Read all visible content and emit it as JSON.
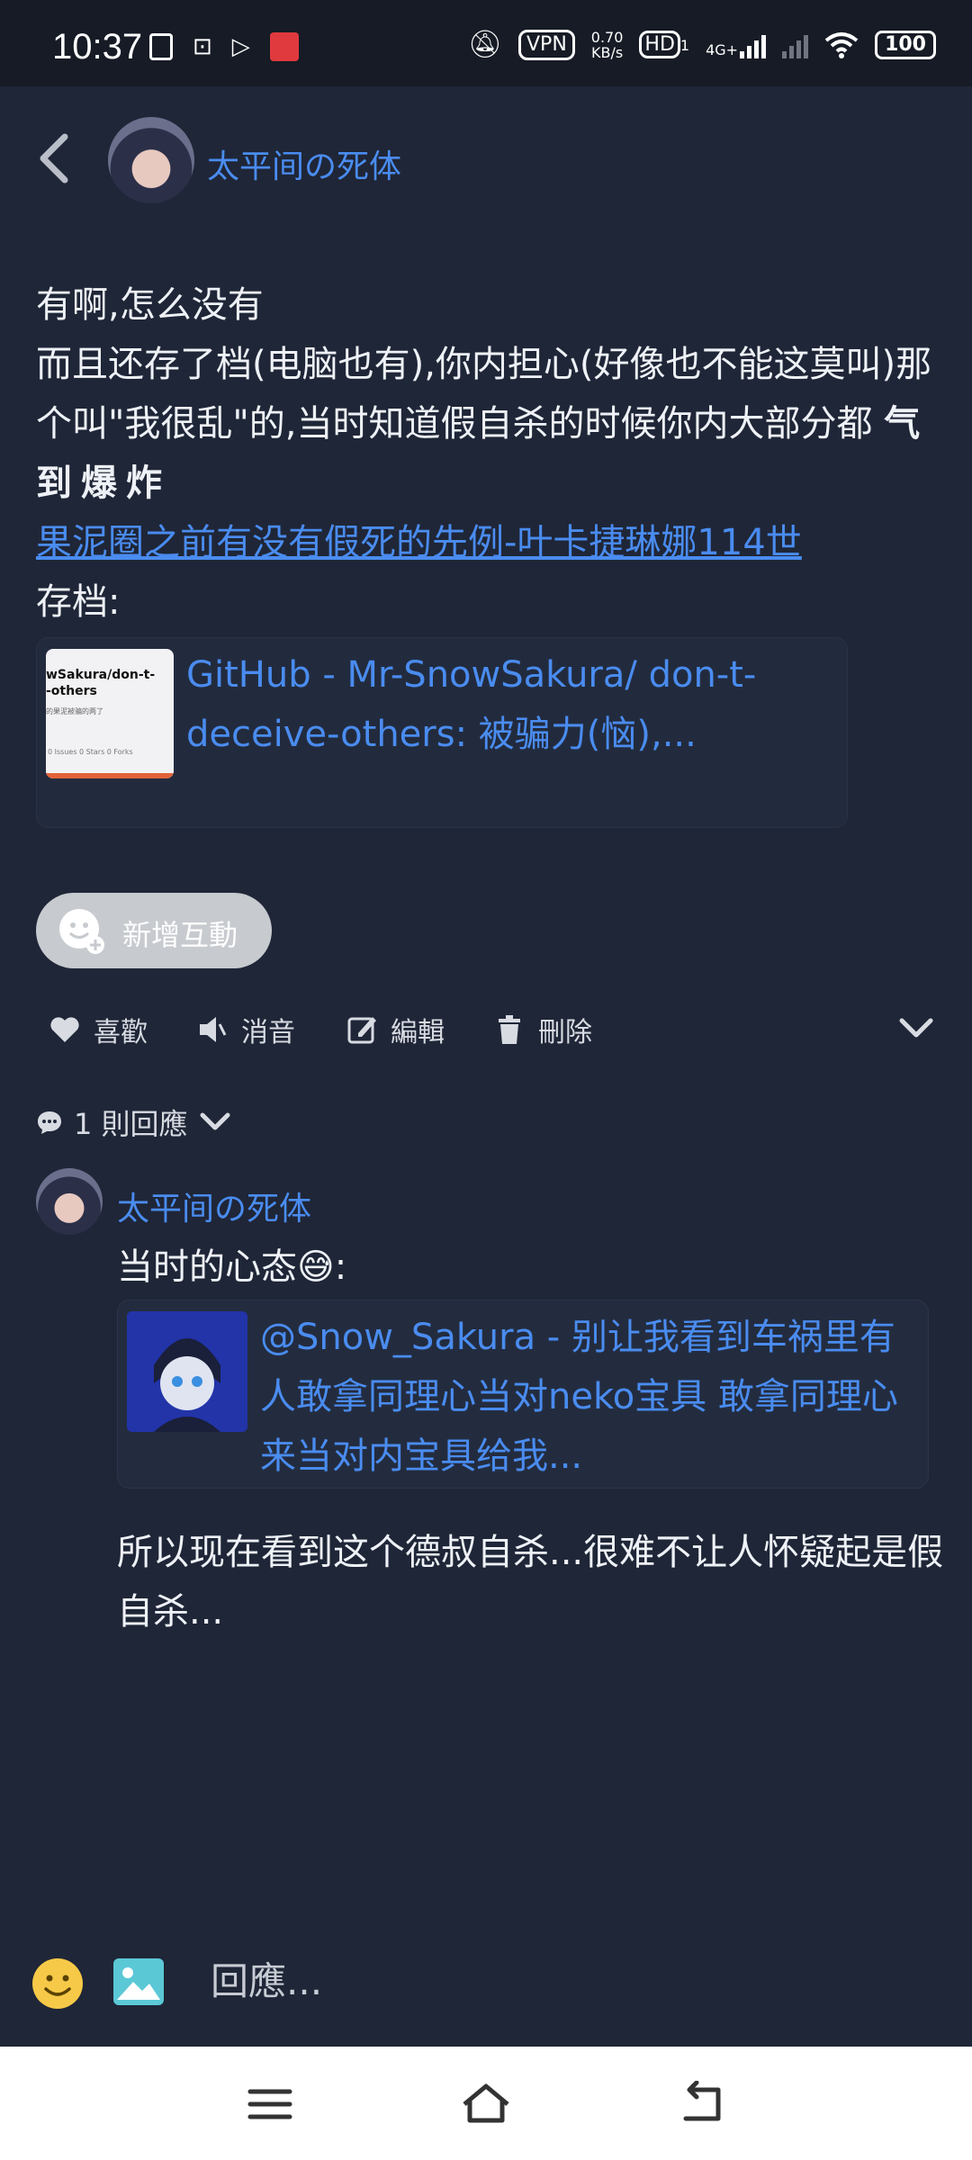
{
  "status_bar": {
    "time": "10:37",
    "vpn": "VPN",
    "speed_value": "0.70",
    "speed_unit": "KB/s",
    "hd": "HD",
    "hd_sub": "1",
    "network": "4G+",
    "battery": "100"
  },
  "header": {
    "username": "太平间の死体"
  },
  "post": {
    "line1": "有啊,怎么没有",
    "line2": "而且还存了档(电脑也有),你内担心(好像也不能这莫叫)那个叫\"我很乱\"的,当时知道假自杀的时候你内大部分都 ",
    "line2_bold": "气到爆炸",
    "link_text": "果泥圈之前有没有假死的先例-叶卡捷琳娜114世",
    "line3": "存档:"
  },
  "link_card": {
    "title": "GitHub - Mr-SnowSakura/ don-t-deceive-others: 被骗力(恼),...",
    "thumb_title": "wSakura/don-t-\n-others",
    "thumb_sub": "的果泥被骗的两了",
    "thumb_stats": "0 Issues  0 Stars  0 Forks"
  },
  "reaction": {
    "label": "新增互動"
  },
  "actions": {
    "like": "喜歡",
    "mute": "消音",
    "edit": "編輯",
    "delete": "刪除"
  },
  "replies": {
    "count_label": "1 則回應"
  },
  "reply": {
    "username": "太平间の死体",
    "text": "当时的心态😅:",
    "quote": "@Snow_Sakura - 别让我看到车祸里有人敢拿同理心当对neko宝具 敢拿同理心来当对内宝具给我...",
    "tail": "所以现在看到这个德叔自杀...很难不让人怀疑起是假自杀..."
  },
  "composer": {
    "placeholder": "回應..."
  },
  "colors": {
    "background": "#1f2637",
    "accent": "#4a8cf0",
    "status_bar": "#161b25"
  }
}
